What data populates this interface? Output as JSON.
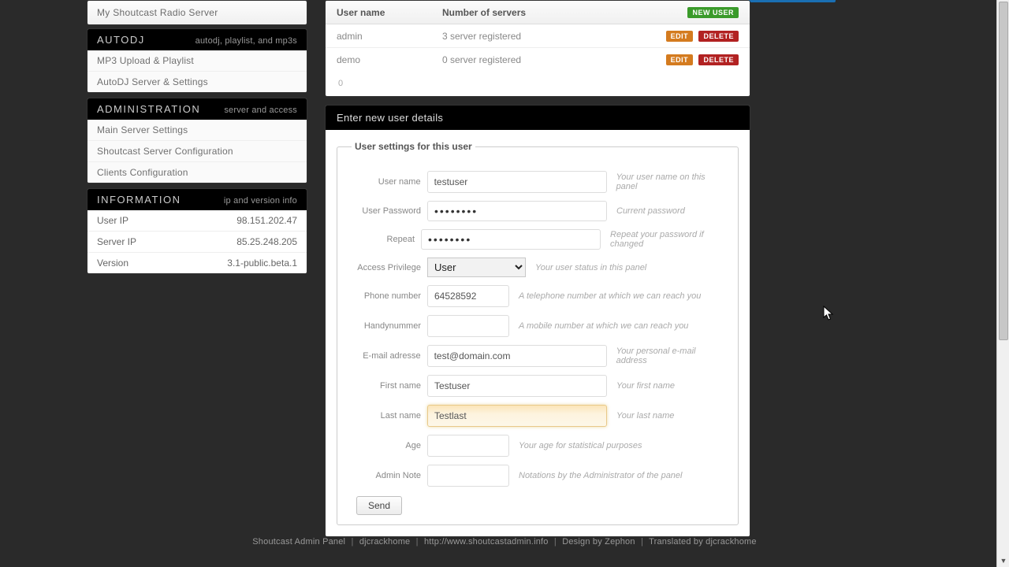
{
  "sidebar": {
    "topItem": "My Shoutcast Radio Server",
    "autodj": {
      "title": "AUTODJ",
      "subtitle": "autodj, playlist, and mp3s",
      "items": [
        "MP3 Upload & Playlist",
        "AutoDJ Server & Settings"
      ]
    },
    "admin": {
      "title": "ADMINISTRATION",
      "subtitle": "server and access",
      "items": [
        "Main Server Settings",
        "Shoutcast Server Configuration",
        "Clients Configuration"
      ]
    },
    "info": {
      "title": "INFORMATION",
      "subtitle": "ip and version info",
      "userIpLabel": "User IP",
      "userIp": "98.151.202.47",
      "serverIpLabel": "Server IP",
      "serverIp": "85.25.248.205",
      "versionLabel": "Version",
      "version": "3.1-public.beta.1"
    }
  },
  "users": {
    "colUser": "User name",
    "colServers": "Number of servers",
    "newUser": "NEW USER",
    "edit": "EDIT",
    "delete": "DELETE",
    "rows": [
      {
        "name": "admin",
        "servers": "3 server registered"
      },
      {
        "name": "demo",
        "servers": "0 server registered"
      }
    ],
    "pager": "0"
  },
  "form": {
    "header": "Enter new user details",
    "legend": "User settings for this user",
    "username": {
      "label": "User name",
      "value": "testuser",
      "hint": "Your user name on this panel"
    },
    "password": {
      "label": "User Password",
      "value": "••••••••",
      "hint": "Current password"
    },
    "repeat": {
      "label": "Repeat",
      "value": "••••••••",
      "hint": "Repeat your password if changed"
    },
    "privilege": {
      "label": "Access Privilege",
      "value": "User",
      "hint": "Your user status in this panel"
    },
    "phone": {
      "label": "Phone number",
      "value": "64528592",
      "hint": "A telephone number at which we can reach you"
    },
    "handy": {
      "label": "Handynummer",
      "value": "",
      "hint": "A mobile number at which we can reach you"
    },
    "email": {
      "label": "E-mail adresse",
      "value": "test@domain.com",
      "hint": "Your personal e-mail address"
    },
    "firstname": {
      "label": "First name",
      "value": "Testuser",
      "hint": "Your first name"
    },
    "lastname": {
      "label": "Last name",
      "value": "Testlast",
      "hint": "Your last name"
    },
    "age": {
      "label": "Age",
      "value": "",
      "hint": "Your age for statistical purposes"
    },
    "note": {
      "label": "Admin Note",
      "value": "",
      "hint": "Notations by the Administrator of the panel"
    },
    "send": "Send"
  },
  "footer": {
    "p1": "Shoutcast Admin Panel",
    "p2": "djcrackhome",
    "p3": "http://www.shoutcastadmin.info",
    "p4": "Design by Zephon",
    "p5": "Translated by djcrackhome"
  }
}
